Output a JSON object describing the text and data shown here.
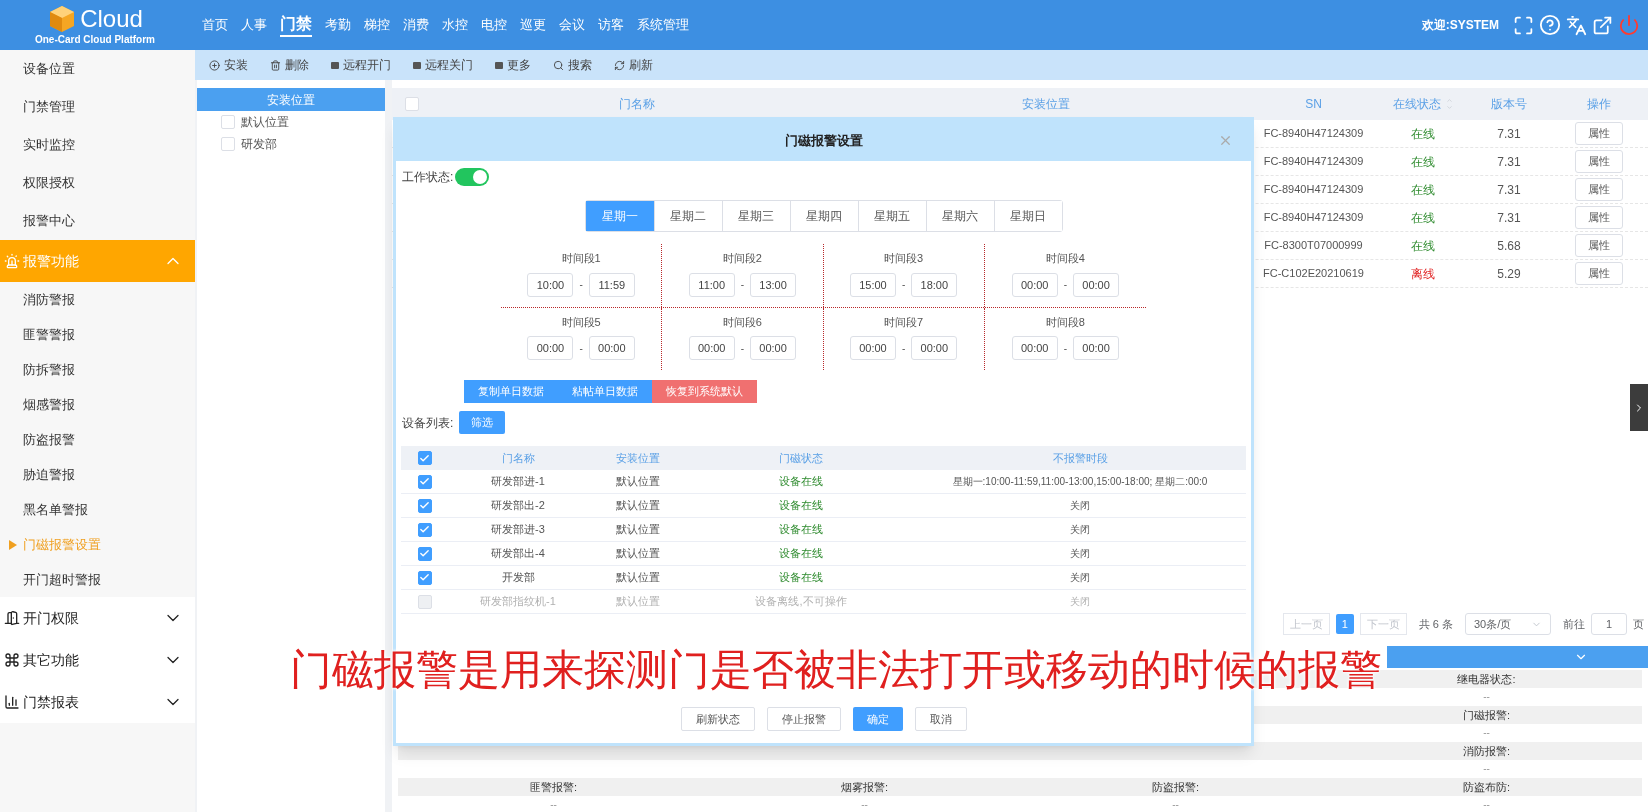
{
  "header": {
    "logo_text": "Cloud",
    "logo_subtitle": "One-Card Cloud Platform",
    "nav": [
      {
        "label": "首页",
        "selected": false
      },
      {
        "label": "人事",
        "selected": false
      },
      {
        "label": "门禁",
        "selected": true
      },
      {
        "label": "考勤",
        "selected": false
      },
      {
        "label": "梯控",
        "selected": false
      },
      {
        "label": "消费",
        "selected": false
      },
      {
        "label": "水控",
        "selected": false
      },
      {
        "label": "电控",
        "selected": false
      },
      {
        "label": "巡更",
        "selected": false
      },
      {
        "label": "会议",
        "selected": false
      },
      {
        "label": "访客",
        "selected": false
      },
      {
        "label": "系统管理",
        "selected": false
      }
    ],
    "welcome": "欢迎:SYSTEM"
  },
  "sidebar": {
    "items": [
      {
        "kind": "link",
        "label": "设备位置"
      },
      {
        "kind": "link",
        "label": "门禁管理"
      },
      {
        "kind": "link",
        "label": "实时监控"
      },
      {
        "kind": "link",
        "label": "权限授权"
      },
      {
        "kind": "link",
        "label": "报警中心"
      },
      {
        "kind": "group",
        "label": "报警功能",
        "expanded": true,
        "children": [
          {
            "label": "消防警报",
            "selected": false
          },
          {
            "label": "匪警警报",
            "selected": false
          },
          {
            "label": "防拆警报",
            "selected": false
          },
          {
            "label": "烟感警报",
            "selected": false
          },
          {
            "label": "防盗报警",
            "selected": false
          },
          {
            "label": "胁迫警报",
            "selected": false
          },
          {
            "label": "黑名单警报",
            "selected": false
          },
          {
            "label": "门磁报警设置",
            "selected": true
          },
          {
            "label": "开门超时警报",
            "selected": false
          }
        ]
      },
      {
        "kind": "group",
        "label": "开门权限",
        "expanded": false
      },
      {
        "kind": "group",
        "label": "其它功能",
        "expanded": false
      },
      {
        "kind": "group",
        "label": "门禁报表",
        "expanded": false
      }
    ]
  },
  "toolbar": [
    "安装",
    "删除",
    "远程开门",
    "远程关门",
    "更多",
    "搜索",
    "刷新"
  ],
  "location_panel": {
    "title": "安装位置",
    "items": [
      {
        "label": "默认位置",
        "checked": false
      },
      {
        "label": "研发部",
        "checked": false
      }
    ]
  },
  "table": {
    "header_checked": false,
    "columns": [
      "门名称",
      "安装位置",
      "SN",
      "在线状态",
      "版本号",
      "操作"
    ],
    "rows": [
      {
        "sn": "FC-8940H47124309",
        "status": "在线",
        "online": true,
        "version": "7.31",
        "action": "属性"
      },
      {
        "sn": "FC-8940H47124309",
        "status": "在线",
        "online": true,
        "version": "7.31",
        "action": "属性"
      },
      {
        "sn": "FC-8940H47124309",
        "status": "在线",
        "online": true,
        "version": "7.31",
        "action": "属性"
      },
      {
        "sn": "FC-8940H47124309",
        "status": "在线",
        "online": true,
        "version": "7.31",
        "action": "属性"
      },
      {
        "sn": "FC-8300T07000999",
        "status": "在线",
        "online": true,
        "version": "5.68",
        "action": "属性"
      },
      {
        "sn": "FC-C102E20210619",
        "status": "离线",
        "online": false,
        "version": "5.29",
        "action": "属性"
      }
    ]
  },
  "pagination": {
    "prev": "上一页",
    "pages": [
      {
        "label": "1",
        "selected": true
      }
    ],
    "next": "下一页",
    "total": "共 6 条",
    "page_size": "30条/页",
    "goto": "前往",
    "goto_value": "1",
    "page_unit": "页"
  },
  "detail_panel": {
    "rows": [
      [
        null,
        null,
        null,
        {
          "label": "继电器状态:",
          "value": "--"
        }
      ],
      [
        null,
        null,
        null,
        {
          "label": "门磁报警:",
          "value": "--"
        }
      ],
      [
        null,
        null,
        null,
        {
          "label": "消防报警:",
          "value": "--"
        }
      ],
      [
        {
          "label": "匪警报警:",
          "value": "--"
        },
        {
          "label": "烟雾报警:",
          "value": "--"
        },
        {
          "label": "防盗报警:",
          "value": "--"
        },
        {
          "label": "防盗布防:",
          "value": "--"
        }
      ]
    ]
  },
  "modal": {
    "title": "门磁报警设置",
    "work_status": {
      "label": "工作状态:",
      "on": true
    },
    "weekdays": [
      {
        "label": "星期一",
        "selected": true
      },
      {
        "label": "星期二",
        "selected": false
      },
      {
        "label": "星期三",
        "selected": false
      },
      {
        "label": "星期四",
        "selected": false
      },
      {
        "label": "星期五",
        "selected": false
      },
      {
        "label": "星期六",
        "selected": false
      },
      {
        "label": "星期日",
        "selected": false
      }
    ],
    "periods": [
      {
        "label": "时间段1",
        "start": "10:00",
        "separator": "-",
        "end": "11:59"
      },
      {
        "label": "时间段2",
        "start": "11:00",
        "separator": "-",
        "end": "13:00"
      },
      {
        "label": "时间段3",
        "start": "15:00",
        "separator": "-",
        "end": "18:00"
      },
      {
        "label": "时间段4",
        "start": "00:00",
        "separator": "-",
        "end": "00:00"
      },
      {
        "label": "时间段5",
        "start": "00:00",
        "separator": "-",
        "end": "00:00"
      },
      {
        "label": "时间段6",
        "start": "00:00",
        "separator": "-",
        "end": "00:00"
      },
      {
        "label": "时间段7",
        "start": "00:00",
        "separator": "-",
        "end": "00:00"
      },
      {
        "label": "时间段8",
        "start": "00:00",
        "separator": "-",
        "end": "00:00"
      }
    ],
    "actions": [
      {
        "label": "复制单日数据",
        "kind": "primary"
      },
      {
        "label": "粘帖单日数据",
        "kind": "primary"
      },
      {
        "label": "恢复到系统默认",
        "kind": "danger"
      }
    ],
    "device_list_label": "设备列表:",
    "filter_button": "筛选",
    "devices": {
      "all_checked": true,
      "columns": [
        "门名称",
        "安装位置",
        "门磁状态",
        "不报警时段"
      ],
      "rows": [
        {
          "name": "研发部进-1",
          "location": "默认位置",
          "status": "设备在线",
          "schedule": "星期一:10:00-11:59,11:00-13:00,15:00-18:00; 星期二:00:0",
          "checked": true,
          "disabled": false
        },
        {
          "name": "研发部出-2",
          "location": "默认位置",
          "status": "设备在线",
          "schedule": "关闭",
          "checked": true,
          "disabled": false
        },
        {
          "name": "研发部进-3",
          "location": "默认位置",
          "status": "设备在线",
          "schedule": "关闭",
          "checked": true,
          "disabled": false
        },
        {
          "name": "研发部出-4",
          "location": "默认位置",
          "status": "设备在线",
          "schedule": "关闭",
          "checked": true,
          "disabled": false
        },
        {
          "name": "开发部",
          "location": "默认位置",
          "status": "设备在线",
          "schedule": "关闭",
          "checked": true,
          "disabled": false
        },
        {
          "name": "研发部指纹机-1",
          "location": "默认位置",
          "status": "设备离线,不可操作",
          "schedule": "关闭",
          "checked": false,
          "disabled": true
        }
      ]
    },
    "footer": [
      {
        "label": "刷新状态",
        "kind": "default"
      },
      {
        "label": "停止报警",
        "kind": "default"
      },
      {
        "label": "确定",
        "kind": "primary"
      },
      {
        "label": "取消",
        "kind": "default"
      }
    ]
  },
  "subtitle": "门磁报警是用来探测门是否被非法打开或移动的时候的报警"
}
